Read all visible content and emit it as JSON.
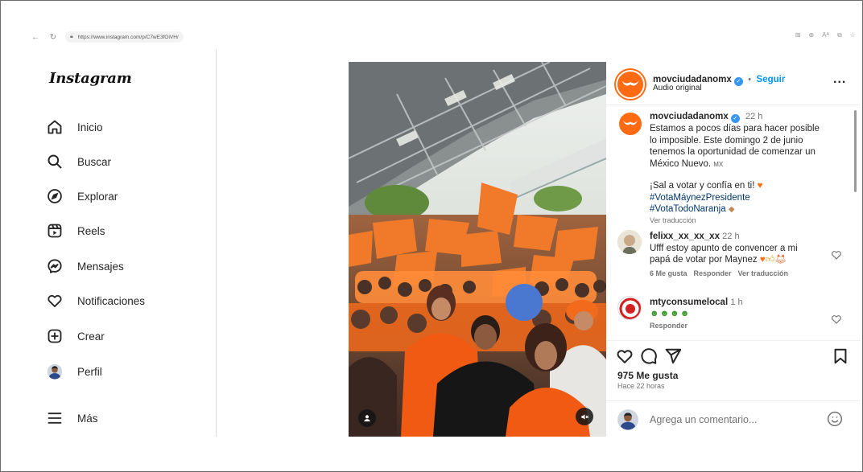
{
  "browser": {
    "url": "https://www.instagram.com/p/C7wE3fOiVH/",
    "lock_icon": "lock-icon",
    "tools": [
      "tabs-icon",
      "zoom-icon",
      "read-aloud-icon",
      "immersive-reader-icon",
      "favorite-star-icon"
    ]
  },
  "sidebar": {
    "logo": "Instagram",
    "items": [
      {
        "label": "Inicio",
        "icon": "home-icon"
      },
      {
        "label": "Buscar",
        "icon": "search-icon"
      },
      {
        "label": "Explorar",
        "icon": "compass-icon"
      },
      {
        "label": "Reels",
        "icon": "reels-icon"
      },
      {
        "label": "Mensajes",
        "icon": "messenger-icon"
      },
      {
        "label": "Notificaciones",
        "icon": "heart-icon"
      },
      {
        "label": "Crear",
        "icon": "plus-square-icon"
      },
      {
        "label": "Perfil",
        "icon": "profile-avatar"
      },
      {
        "label": "Más",
        "icon": "hamburger-menu-icon"
      }
    ]
  },
  "post": {
    "author": "movciudadanomx",
    "follow_separator": "•",
    "follow_label": "Seguir",
    "audio": "Audio original",
    "more_icon": "...",
    "caption": {
      "time": "22 h",
      "line1": "Estamos a pocos días para hacer posible",
      "line2": "lo imposible. Este domingo 2 de junio",
      "line3": "tenemos la oportunidad de comenzar un",
      "line4": "México Nuevo. ",
      "flag": "MX",
      "line5": "¡Sal a votar y confía en ti! ",
      "hashtag1": "#VotaMáynezPresidente",
      "hashtag2": "#VotaTodoNaranja ",
      "translate": "Ver traducción"
    },
    "comments": [
      {
        "user": "felixx_xx_xx_xx",
        "time": "22 h",
        "line1": "Ufff estoy apunto de convencer a mi",
        "line2": "papá de votar por Maynez ",
        "likes": "6 Me gusta",
        "reply": "Responder",
        "translate": "Ver traducción"
      },
      {
        "user": "mtyconsumelocal",
        "time": "1 h",
        "reply": "Responder"
      }
    ],
    "likes": "975 Me gusta",
    "posted": "Hace 22 horas",
    "comment_placeholder": "Agrega un comentario...",
    "accent_color": "#ff6a13",
    "link_color": "#0095f6"
  }
}
